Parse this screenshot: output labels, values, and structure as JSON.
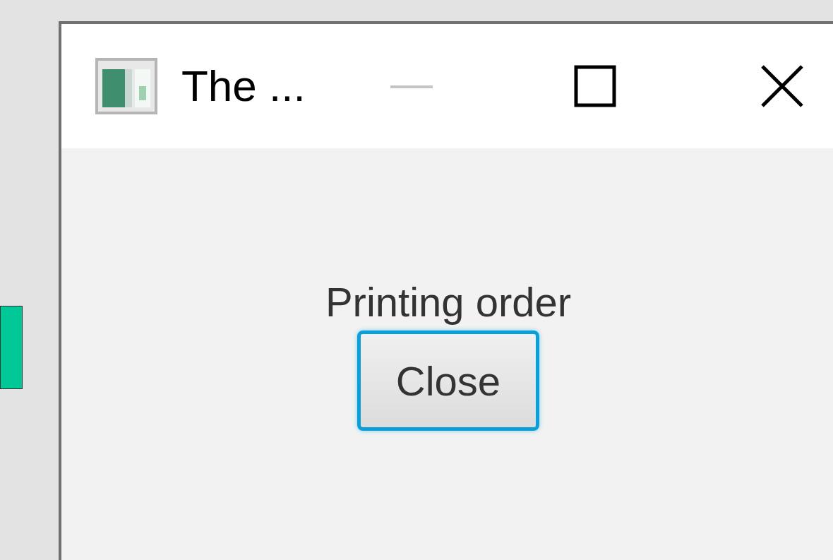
{
  "window": {
    "title": "The ...",
    "controls": [
      {
        "kind": "minimize",
        "disabled": true
      },
      {
        "kind": "maximize",
        "disabled": false
      },
      {
        "kind": "close",
        "disabled": false
      }
    ]
  },
  "message": "Printing order",
  "button": {
    "label": "Close",
    "focused": true
  }
}
